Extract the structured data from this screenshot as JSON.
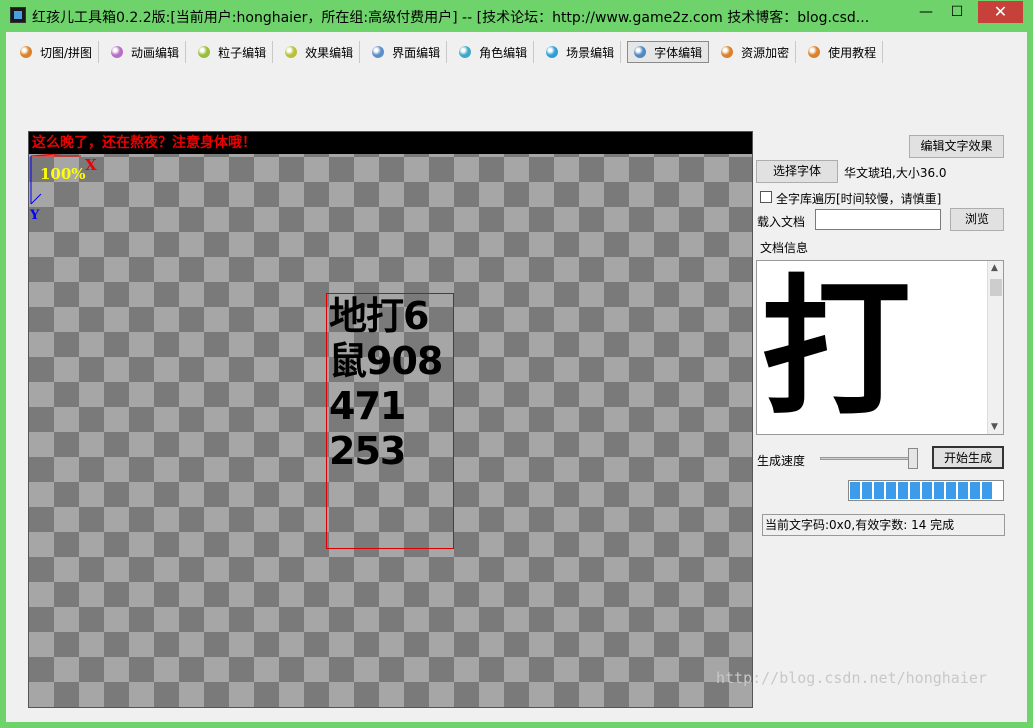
{
  "window": {
    "title": "红孩儿工具箱0.2.2版:[当前用户:honghaier，所在组:高级付费用户]  --  [技术论坛：http://www.game2z.com 技术博客：blog.csd...",
    "minimize": "—",
    "maximize": "☐",
    "close": "✕"
  },
  "tabs": [
    {
      "label": "切图/拼图",
      "icon": "orange-ball-icon",
      "color": "#d9822b"
    },
    {
      "label": "动画编辑",
      "icon": "purple-ball-icon",
      "color": "#b56fc4"
    },
    {
      "label": "粒子编辑",
      "icon": "green-ball-icon",
      "color": "#9bbd3a"
    },
    {
      "label": "效果编辑",
      "icon": "lime-ball-icon",
      "color": "#b6c23a"
    },
    {
      "label": "界面编辑",
      "icon": "blue-ball-icon",
      "color": "#5b8fc9"
    },
    {
      "label": "角色编辑",
      "icon": "teal-ball-icon",
      "color": "#3fa8c8"
    },
    {
      "label": "场景编辑",
      "icon": "cyan-ball-icon",
      "color": "#2f9ed6"
    },
    {
      "label": "字体编辑",
      "icon": "steel-ball-icon",
      "color": "#4f88c2",
      "active": true
    },
    {
      "label": "资源加密",
      "icon": "amber-ball-icon",
      "color": "#d9822b"
    },
    {
      "label": "使用教程",
      "icon": "orange-ball-icon",
      "color": "#d9822b"
    }
  ],
  "canvas": {
    "warning": "这么晚了，还在熬夜？注意身体哦！",
    "axis_x": "X",
    "axis_y": "Y",
    "zoom": "100%",
    "glyphs": "地打6\n鼠908\n471\n253"
  },
  "panel": {
    "edit_effect_button": "编辑文字效果",
    "choose_font_button": "选择字体",
    "font_info": "华文琥珀,大小36.0",
    "full_scan_label": "全字库遍历[时间较慢，请慎重]",
    "load_doc_label": "载入文档",
    "load_doc_value": "",
    "browse_button": "浏览",
    "doc_info_label": "文档信息",
    "preview_char": "打",
    "speed_label": "生成速度",
    "speed_level": 1.0,
    "generate_button": "开始生成",
    "progress": 1.0,
    "status_text": "当前文字码:0x0,有效字数: 14 完成"
  },
  "watermark": "http://blog.csdn.net/honghaier",
  "colors": {
    "titlebar": "#6fd36c",
    "close_button": "#c7403a",
    "warning_text": "#e00000",
    "progress": "#3c9bea",
    "glyph_box": "#dd0000"
  }
}
